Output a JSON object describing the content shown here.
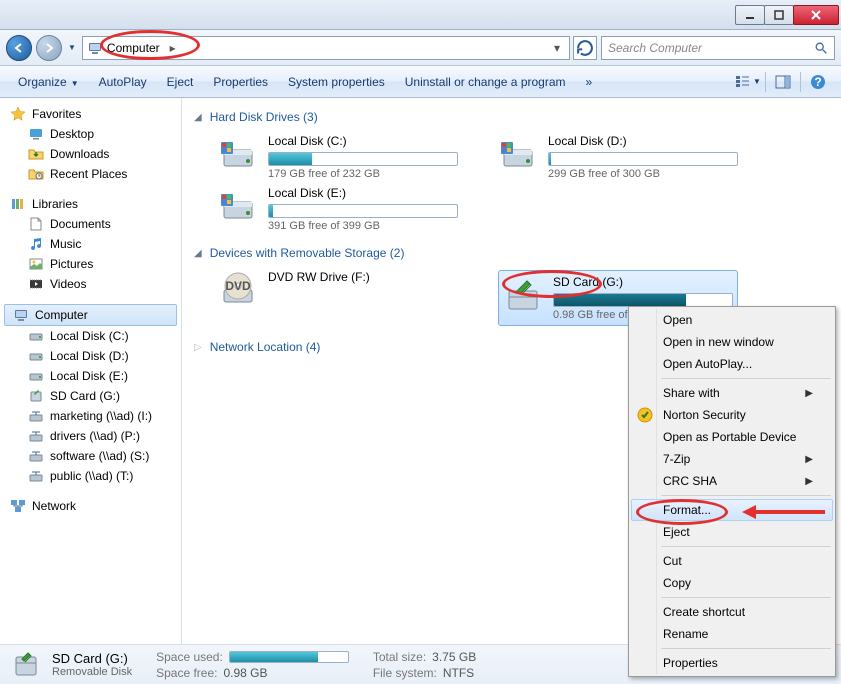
{
  "title": "",
  "address": {
    "icon": "computer",
    "text": "Computer"
  },
  "search": {
    "placeholder": "Search Computer"
  },
  "toolbar": {
    "organize": "Organize",
    "autoplay": "AutoPlay",
    "eject": "Eject",
    "properties": "Properties",
    "sysprops": "System properties",
    "uninstall": "Uninstall or change a program",
    "more": "»"
  },
  "sidebar": {
    "favorites": {
      "label": "Favorites",
      "items": [
        "Desktop",
        "Downloads",
        "Recent Places"
      ]
    },
    "libraries": {
      "label": "Libraries",
      "items": [
        "Documents",
        "Music",
        "Pictures",
        "Videos"
      ]
    },
    "computer": {
      "label": "Computer",
      "items": [
        "Local Disk (C:)",
        "Local Disk (D:)",
        "Local Disk (E:)",
        "SD Card (G:)",
        "marketing (\\\\ad) (I:)",
        "drivers (\\\\ad) (P:)",
        "software (\\\\ad) (S:)",
        "public (\\\\ad) (T:)"
      ]
    },
    "network": {
      "label": "Network"
    }
  },
  "sections": {
    "hdd": {
      "title": "Hard Disk Drives (3)",
      "drives": [
        {
          "name": "Local Disk (C:)",
          "free": "179 GB free of 232 GB",
          "fill": 23
        },
        {
          "name": "Local Disk (D:)",
          "free": "299 GB free of 300 GB",
          "fill": 1
        },
        {
          "name": "Local Disk (E:)",
          "free": "391 GB free of 399 GB",
          "fill": 2
        }
      ]
    },
    "removable": {
      "title": "Devices with Removable Storage (2)",
      "drives": [
        {
          "name": "DVD RW Drive (F:)",
          "type": "dvd"
        },
        {
          "name": "SD Card (G:)",
          "free": "0.98 GB free of 3.75 GB",
          "fill": 74,
          "selected": true
        }
      ]
    },
    "network": {
      "title": "Network Location (4)"
    }
  },
  "details": {
    "name": "SD Card (G:)",
    "type": "Removable Disk",
    "space_used_label": "Space used:",
    "space_free_label": "Space free:",
    "space_free": "0.98 GB",
    "total_label": "Total size:",
    "total": "3.75 GB",
    "fs_label": "File system:",
    "fs": "NTFS"
  },
  "context_menu": {
    "items": [
      {
        "label": "Open"
      },
      {
        "label": "Open in new window"
      },
      {
        "label": "Open AutoPlay..."
      },
      {
        "sep": true
      },
      {
        "label": "Share with",
        "submenu": true
      },
      {
        "label": "Norton Security",
        "icon": "norton"
      },
      {
        "label": "Open as Portable Device"
      },
      {
        "label": "7-Zip",
        "submenu": true
      },
      {
        "label": "CRC SHA",
        "submenu": true
      },
      {
        "sep": true
      },
      {
        "label": "Format...",
        "highlighted": true
      },
      {
        "label": "Eject"
      },
      {
        "sep": true
      },
      {
        "label": "Cut"
      },
      {
        "label": "Copy"
      },
      {
        "sep": true
      },
      {
        "label": "Create shortcut"
      },
      {
        "label": "Rename"
      },
      {
        "sep": true
      },
      {
        "label": "Properties"
      }
    ]
  }
}
